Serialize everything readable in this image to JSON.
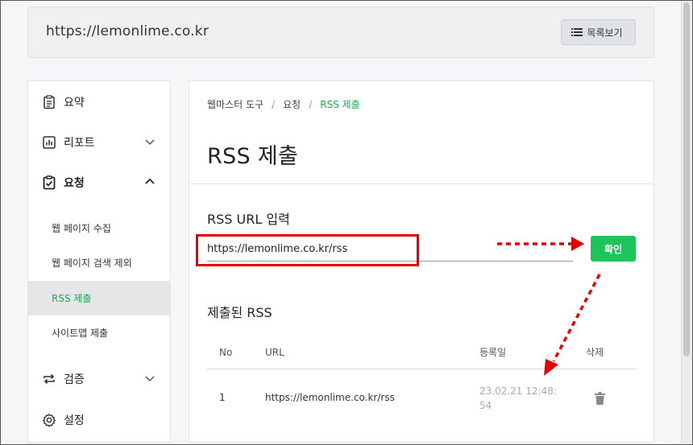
{
  "header": {
    "site_url": "https://lemonlime.co.kr",
    "list_button_label": "목록보기"
  },
  "sidebar": {
    "items": [
      {
        "label": "요약",
        "icon": "clipboard-list-icon"
      },
      {
        "label": "리포트",
        "icon": "bar-chart-icon"
      },
      {
        "label": "요청",
        "icon": "clipboard-check-icon"
      },
      {
        "label": "검증",
        "icon": "repeat-icon"
      },
      {
        "label": "설정",
        "icon": "gear-icon"
      }
    ],
    "sub_items": [
      {
        "label": "웹 페이지 수집"
      },
      {
        "label": "웹 페이지 검색 제외"
      },
      {
        "label": "RSS 제출"
      },
      {
        "label": "사이트맵 제출"
      }
    ]
  },
  "main": {
    "breadcrumb": [
      "웹마스터 도구",
      "요청",
      "RSS 제출"
    ],
    "title": "RSS 제출",
    "input_label": "RSS URL 입력",
    "input_value": "https://lemonlime.co.kr/rss",
    "confirm_label": "확인",
    "submitted_label": "제출된 RSS",
    "table": {
      "headers": [
        "No",
        "URL",
        "등록일",
        "삭제"
      ],
      "rows": [
        {
          "no": "1",
          "url": "https://lemonlime.co.kr/rss",
          "date": "23.02.21 12:48:54"
        }
      ]
    }
  },
  "colors": {
    "accent_green": "#1aab52",
    "button_green": "#1ec35a",
    "annotation_red": "#e30000"
  }
}
